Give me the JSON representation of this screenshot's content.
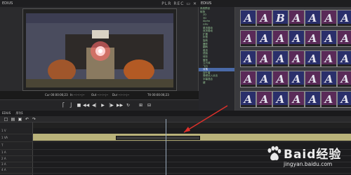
{
  "app": {
    "title": "EDIUS",
    "player_label": "PLR",
    "player_rec": "REC",
    "bin_label": "EDIUS"
  },
  "timecodes": {
    "cur": "Cur 00:00:06;23",
    "in": "In --:--:--;--",
    "out": "Out --:--:--;--",
    "dur": "Dur --:--:--;--",
    "ttl": "Ttl 00:00:06;23"
  },
  "tree": {
    "items": [
      "系统预设",
      "转场",
      "2D",
      "3D",
      "Alpha",
      "GPU",
      "单页卷动",
      "双页卷动",
      "扩展",
      "折叠",
      "旋转",
      "爆炸",
      "翻转",
      "卷页",
      "扭曲",
      "球形",
      "管状",
      "立方体",
      "飞行",
      "对角",
      "百叶窗",
      "音频淡入淡出",
      "字幕混合",
      "键"
    ]
  },
  "thumbs": [
    "A",
    "A",
    "B",
    "A",
    "A",
    "A",
    "A",
    "A",
    "A",
    "A",
    "A",
    "A",
    "A",
    "A",
    "A",
    "A",
    "A",
    "A",
    "A",
    "A",
    "A",
    "A",
    "A",
    "A",
    "A",
    "A",
    "A",
    "A",
    "A",
    "A",
    "A",
    "A",
    "A",
    "A",
    "A"
  ],
  "timeline": {
    "tab": "序列1",
    "tracks": [
      "1 V",
      "1 VA",
      "T",
      "1 A",
      "2 A",
      "3 A",
      "4 A"
    ]
  },
  "watermark": {
    "brand": "Baid经验",
    "url": "jingyan.baidu.com"
  },
  "colors": {
    "accent": "#e0302a",
    "clip": "#b9b27a",
    "thumb_bg": "#2a2f6b"
  }
}
